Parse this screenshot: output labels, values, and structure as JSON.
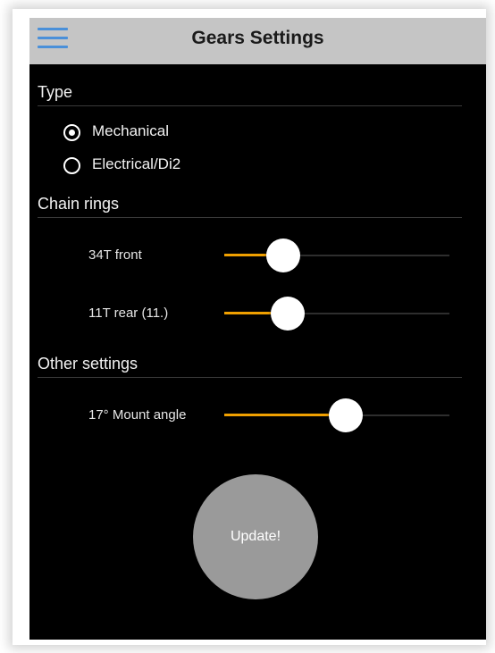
{
  "header": {
    "title": "Gears Settings",
    "menu_icon": "hamburger-menu-icon"
  },
  "type_section": {
    "title": "Type",
    "options": [
      {
        "label": "Mechanical",
        "selected": true
      },
      {
        "label": "Electrical/Di2",
        "selected": false
      }
    ]
  },
  "chain_rings_section": {
    "title": "Chain rings",
    "sliders": [
      {
        "label": "34T front",
        "value_fraction": 0.26
      },
      {
        "label": "11T rear (11.)",
        "value_fraction": 0.28
      }
    ]
  },
  "other_settings_section": {
    "title": "Other settings",
    "sliders": [
      {
        "label": "17° Mount angle",
        "value_fraction": 0.54
      }
    ]
  },
  "update_button": {
    "label": "Update!"
  },
  "colors": {
    "accent": "#f0a000",
    "menu_icon": "#4a90d9",
    "topbar": "#c5c5c5",
    "background": "#000000",
    "button": "#9a9a9a"
  }
}
